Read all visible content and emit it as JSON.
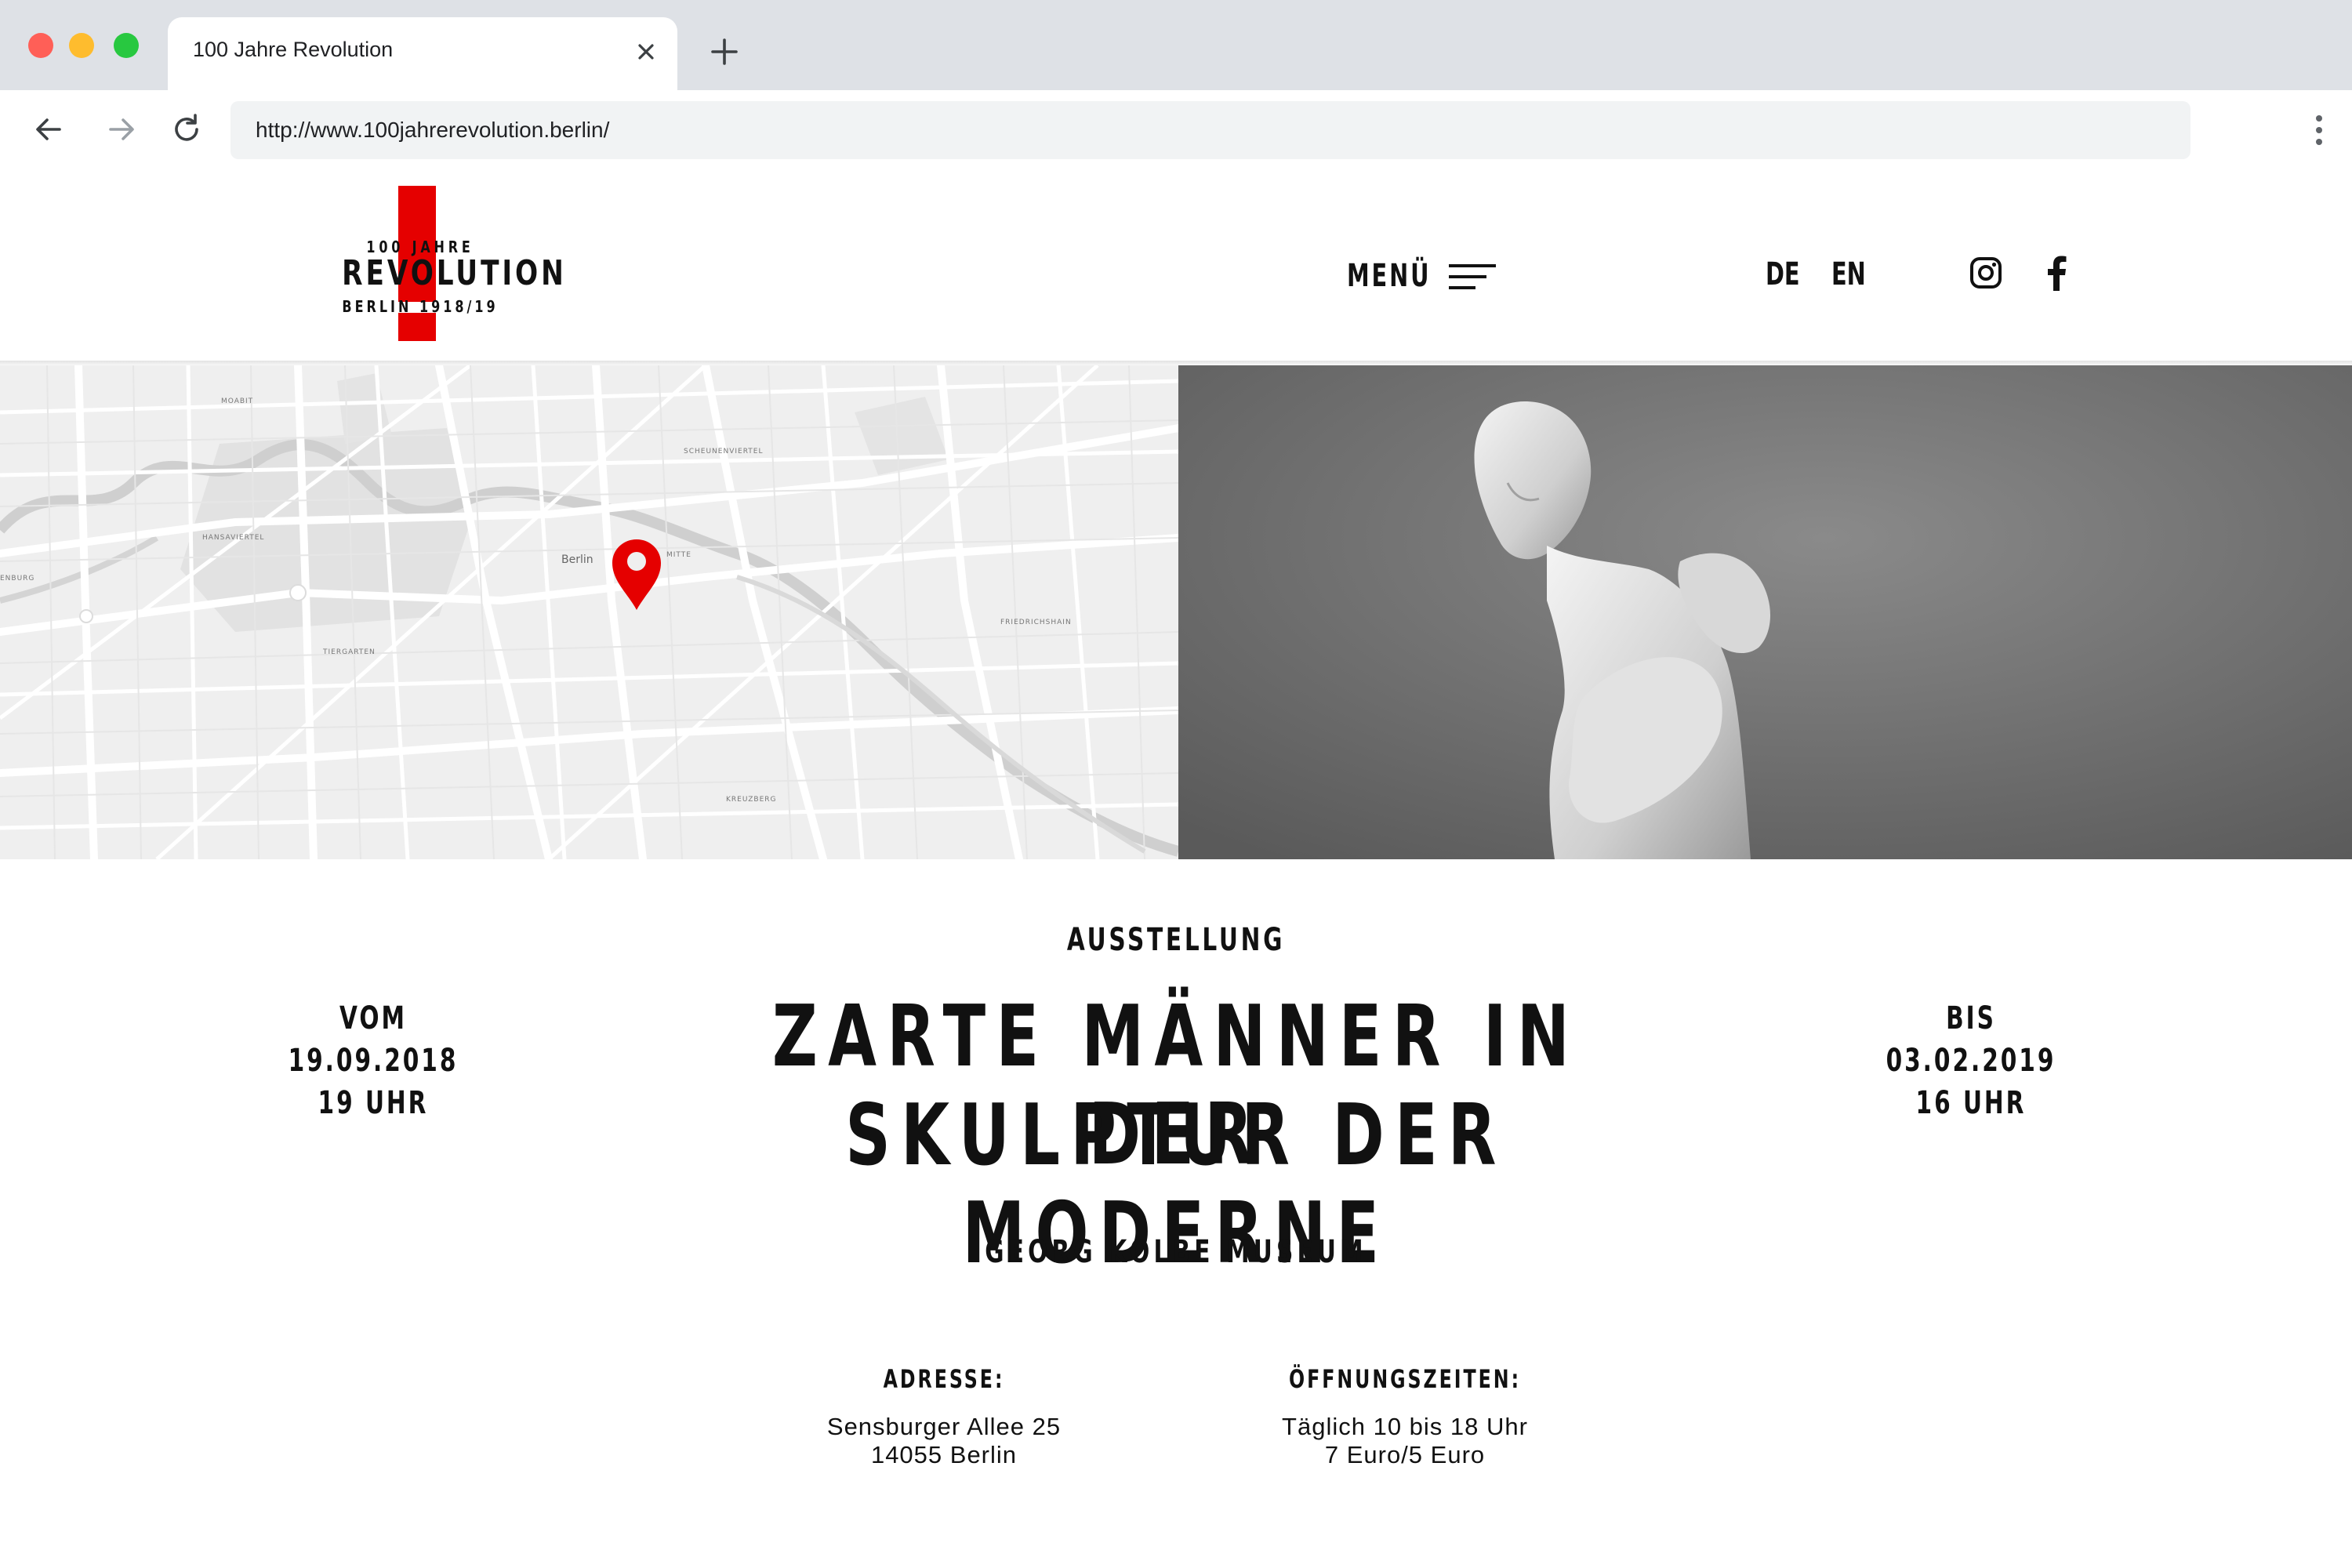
{
  "browser": {
    "tab_title": "100 Jahre Revolution",
    "url": "http://www.100jahrerevolution.berlin/"
  },
  "header": {
    "logo": {
      "top": "100 JAHRE",
      "main": "REVOLUTION",
      "bottom": "BERLIN 1918/19"
    },
    "menu_label": "MENÜ",
    "languages": [
      "DE",
      "EN"
    ],
    "social_icons": [
      "instagram-icon",
      "facebook-icon"
    ]
  },
  "map": {
    "labels": [
      "MOABIT",
      "SCHEUNENVIERTEL",
      "HANSAVIERTEL",
      "Berlin",
      "MITTE",
      "TIERGARTEN",
      "FRIEDRICHSHAIN",
      "KREUZBERG",
      "ENBURG"
    ],
    "pin_color": "#e50000"
  },
  "event": {
    "type": "AUSSTELLUNG",
    "title_line1": "ZARTE MÄNNER IN DER",
    "title_line2": "SKULPTUR DER MODERNE",
    "venue": "GEORG KOLBE MUSEUM",
    "from": {
      "label": "VOM",
      "date": "19.09.2018",
      "time": "19 UHR"
    },
    "to": {
      "label": "BIS",
      "date": "03.02.2019",
      "time": "16 UHR"
    },
    "address": {
      "label": "ADRESSE:",
      "line1": "Sensburger Allee 25",
      "line2": "14055 Berlin"
    },
    "hours": {
      "label": "ÖFFNUNGSZEITEN:",
      "line1": "Täglich 10 bis 18 Uhr",
      "line2": "7 Euro/5 Euro"
    }
  },
  "colors": {
    "accent": "#e50000",
    "text": "#111111"
  }
}
